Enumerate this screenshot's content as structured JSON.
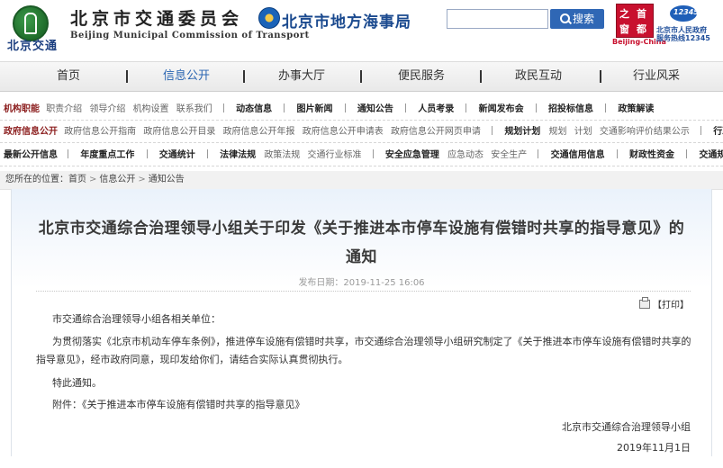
{
  "header": {
    "brand_text": "北京交通",
    "org_name_cn": "北京市交通委员会",
    "org_name_en": "Beijing Municipal Commission of Transport",
    "msa_name": "北京市地方海事局",
    "search": {
      "value": "",
      "placeholder": "",
      "button_label": "搜索",
      "button_icon": "search-icon"
    },
    "capital_logo": {
      "chars": [
        "之",
        "首",
        "窗",
        "都"
      ],
      "caption": "Beijing-China"
    },
    "hotline": {
      "number": "12345",
      "caption_line1": "北京市人民政府",
      "caption_line2": "服务热线12345"
    },
    "colors": {
      "accent": "#2f67b5",
      "red": "#c8102e"
    }
  },
  "main_nav": {
    "items": [
      "首页",
      "信息公开",
      "办事大厅",
      "便民服务",
      "政民互动",
      "行业风采"
    ],
    "active": "信息公开"
  },
  "submenus": {
    "row1": {
      "category": "机构职能",
      "links": [
        "职责介绍",
        "领导介绍",
        "机构设置",
        "联系我们"
      ],
      "sections": [
        "动态信息",
        "图片新闻",
        "通知公告",
        "人员考录",
        "新闻发布会",
        "招投标信息",
        "政策解读"
      ]
    },
    "row2": {
      "category": "政府信息公开",
      "links": [
        "政府信息公开指南",
        "政府信息公开目录",
        "政府信息公开年报",
        "政府信息公开申请表",
        "政府信息公开网页申请"
      ],
      "plan_heading": "规划计划",
      "plan_links": [
        "规划",
        "计划",
        "交通影响评价结果公示"
      ],
      "tail_heading": "行政处罚"
    },
    "row3": {
      "category": "最新公开信息",
      "group1": "年度重点工作",
      "group2": "交通统计",
      "group3_heading": "法律法规",
      "group3_links": [
        "政策法规",
        "交通行业标准"
      ],
      "group4_heading": "安全应急管理",
      "group4_links": [
        "应急动态",
        "安全生产"
      ],
      "tail_items": [
        "交通信用信息",
        "财政性资金",
        "交通规费"
      ]
    }
  },
  "breadcrumb": {
    "prefix": "您所在的位置：",
    "items": [
      "首页",
      "信息公开",
      "通知公告"
    ],
    "separator": ">"
  },
  "article": {
    "title": "北京市交通综合治理领导小组关于印发《关于推进本市停车设施有偿错时共享的指导意见》的通知",
    "publish_label": "发布日期：2019-11-25 16:06",
    "print_label": "【打印】",
    "salutation": "市交通综合治理领导小组各相关单位：",
    "para1": "为贯彻落实《北京市机动车停车条例》，推进停车设施有偿错时共享，市交通综合治理领导小组研究制定了《关于推进本市停车设施有偿错时共享的指导意见》，经市政府同意，现印发给你们，请结合实际认真贯彻执行。",
    "notice": "特此通知。",
    "attachment": "附件：《关于推进本市停车设施有偿错时共享的指导意见》",
    "signer": "北京市交通综合治理领导小组",
    "sign_date": "2019年11月1日"
  }
}
